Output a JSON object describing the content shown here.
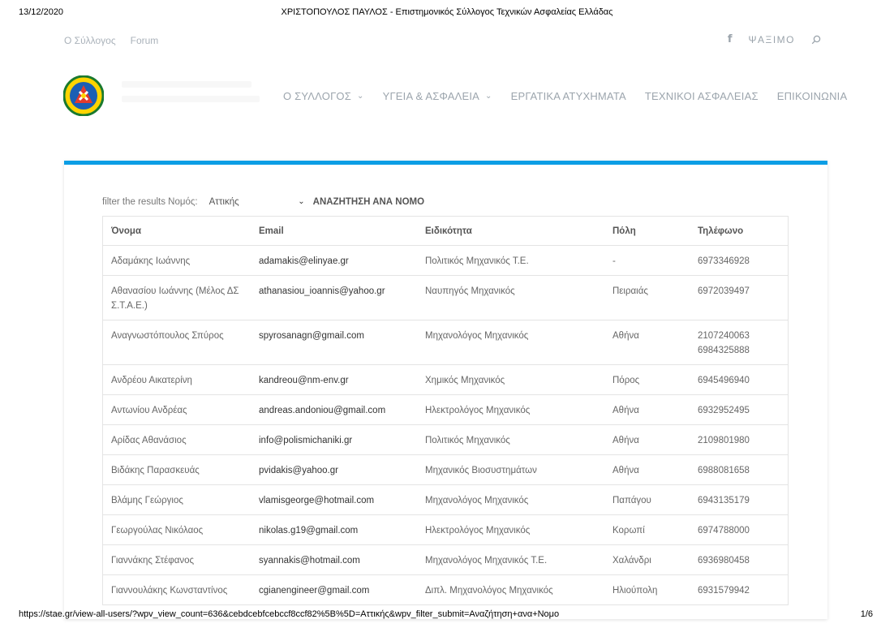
{
  "print": {
    "date": "13/12/2020",
    "title": "ΧΡΙΣΤΟΠΟΥΛΟΣ ΠΑΥΛΟΣ - Επιστημονικός Σύλλογος Τεχνικών Ασφαλείας Ελλάδας",
    "url": "https://stae.gr/view-all-users/?wpv_view_count=636&cebdcebfcebccf8ccf82%5B%5D=Αττικής&wpv_filter_submit=Αναζήτηση+ανα+Νομο",
    "page": "1/6"
  },
  "topbar": {
    "links": [
      "Ο Σύλλογος",
      "Forum"
    ],
    "facebook_icon": "f",
    "search_label": "ΨΑΞΙΜΟ"
  },
  "nav": {
    "items": [
      {
        "label": "Ο ΣΥΛΛΟΓΟΣ",
        "dropdown": true
      },
      {
        "label": "ΥΓΕΙΑ & ΑΣΦΑΛΕΙΑ",
        "dropdown": true
      },
      {
        "label": "ΕΡΓΑΤΙΚΑ ΑΤΥΧΗΜΑΤΑ",
        "dropdown": false
      },
      {
        "label": "ΤΕΧΝΙΚΟΙ ΑΣΦΑΛΕΙΑΣ",
        "dropdown": false
      },
      {
        "label": "ΕΠΙΚΟΙΝΩΝΙΑ",
        "dropdown": false
      }
    ]
  },
  "filter": {
    "label": "filter the results Νομός:",
    "selected": "Αττικής",
    "submit": "ΑΝΑΖΗΤΗΣΗ ΑΝΑ ΝΟΜΟ"
  },
  "table": {
    "headers": [
      "Όνομα",
      "Email",
      "Ειδικότητα",
      "Πόλη",
      "Τηλέφωνο"
    ],
    "rows": [
      [
        "Αδαμάκης Ιωάννης",
        "adamakis@elinyae.gr",
        "Πολιτικός Μηχανικός Τ.Ε.",
        "-",
        "6973346928"
      ],
      [
        "Αθανασίου Ιωάννης (Μέλος ΔΣ Σ.Τ.Α.Ε.)",
        "athanasiou_ioannis@yahoo.gr",
        "Ναυπηγός Μηχανικός",
        "Πειραιάς",
        "6972039497"
      ],
      [
        "Αναγνωστόπουλος Σπύρος",
        "spyrosanagn@gmail.com",
        "Μηχανολόγος Μηχανικός",
        "Αθήνα",
        "2107240063 6984325888"
      ],
      [
        "Ανδρέου Αικατερίνη",
        "kandreou@nm-env.gr",
        "Χημικός Μηχανικός",
        "Πόρος",
        "6945496940"
      ],
      [
        "Αντωνίου Ανδρέας",
        "andreas.andoniou@gmail.com",
        "Ηλεκτρολόγος Μηχανικός",
        "Αθήνα",
        "6932952495"
      ],
      [
        "Αρίδας Αθανάσιος",
        "info@polismichaniki.gr",
        "Πολιτικός Μηχανικός",
        "Αθήνα",
        "2109801980"
      ],
      [
        "Βιδάκης Παρασκευάς",
        "pvidakis@yahoo.gr",
        "Μηχανικός Βιοσυστημάτων",
        "Αθήνα",
        "6988081658"
      ],
      [
        "Βλάμης Γεώργιος",
        "vlamisgeorge@hotmail.com",
        "Μηχανολόγος Μηχανικός",
        "Παπάγου",
        "6943135179"
      ],
      [
        "Γεωργούλας Νικόλαος",
        "nikolas.g19@gmail.com",
        "Ηλεκτρολόγος Μηχανικός",
        "Κορωπί",
        "6974788000"
      ],
      [
        "Γιαννάκης Στέφανος",
        "syannakis@hotmail.com",
        "Μηχανολόγος Μηχανικός Τ.Ε.",
        "Χαλάνδρι",
        "6936980458"
      ],
      [
        "Γιαννουλάκης Κωνσταντίνος",
        "cgianengineer@gmail.com",
        "Διπλ. Μηχανολόγος Μηχανικός",
        "Ηλιούπολη",
        "6931579942"
      ]
    ]
  }
}
